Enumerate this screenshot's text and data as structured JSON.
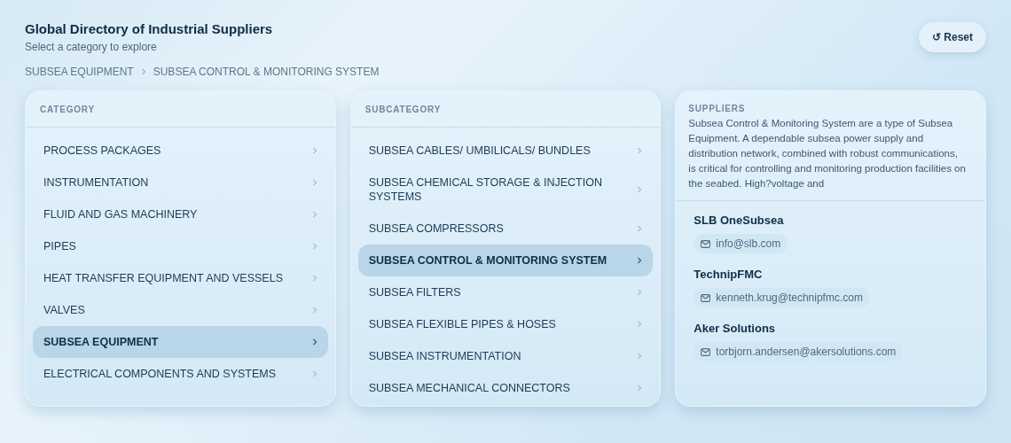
{
  "header": {
    "title": "Global Directory of Industrial Suppliers",
    "subtitle": "Select a category to explore",
    "reset_button": "↺ Reset"
  },
  "breadcrumb": [
    "SUBSEA EQUIPMENT",
    "SUBSEA CONTROL & MONITORING SYSTEM"
  ],
  "category_panel": {
    "heading": "CATEGORY",
    "items": [
      {
        "label": "PROCESS PACKAGES",
        "selected": false
      },
      {
        "label": "INSTRUMENTATION",
        "selected": false
      },
      {
        "label": "FLUID AND GAS MACHINERY",
        "selected": false
      },
      {
        "label": "PIPES",
        "selected": false
      },
      {
        "label": "HEAT TRANSFER EQUIPMENT AND VESSELS",
        "selected": false
      },
      {
        "label": "VALVES",
        "selected": false
      },
      {
        "label": "SUBSEA EQUIPMENT",
        "selected": true
      },
      {
        "label": "ELECTRICAL COMPONENTS AND SYSTEMS",
        "selected": false
      }
    ]
  },
  "subcategory_panel": {
    "heading": "SUBCATEGORY",
    "items": [
      {
        "label": "SUBSEA CABLES/ UMBILICALS/ BUNDLES",
        "selected": false
      },
      {
        "label": "SUBSEA CHEMICAL STORAGE & INJECTION SYSTEMS",
        "selected": false
      },
      {
        "label": "SUBSEA COMPRESSORS",
        "selected": false
      },
      {
        "label": "SUBSEA CONTROL & MONITORING SYSTEM",
        "selected": true
      },
      {
        "label": "SUBSEA FILTERS",
        "selected": false
      },
      {
        "label": "SUBSEA FLEXIBLE PIPES & HOSES",
        "selected": false
      },
      {
        "label": "SUBSEA INSTRUMENTATION",
        "selected": false
      },
      {
        "label": "SUBSEA MECHANICAL CONNECTORS",
        "selected": false
      }
    ]
  },
  "suppliers_panel": {
    "heading": "SUPPLIERS",
    "description": "Subsea Control & Monitoring System are a type of Subsea Equipment. A dependable subsea power supply and distribution network, combined with robust communications, is critical for controlling and monitoring production facilities on the seabed. High?voltage and",
    "suppliers": [
      {
        "name": "SLB OneSubsea",
        "email": "info@slb.com"
      },
      {
        "name": "TechnipFMC",
        "email": "kenneth.krug@technipfmc.com"
      },
      {
        "name": "Aker Solutions",
        "email": "torbjorn.andersen@akersolutions.com"
      }
    ]
  }
}
